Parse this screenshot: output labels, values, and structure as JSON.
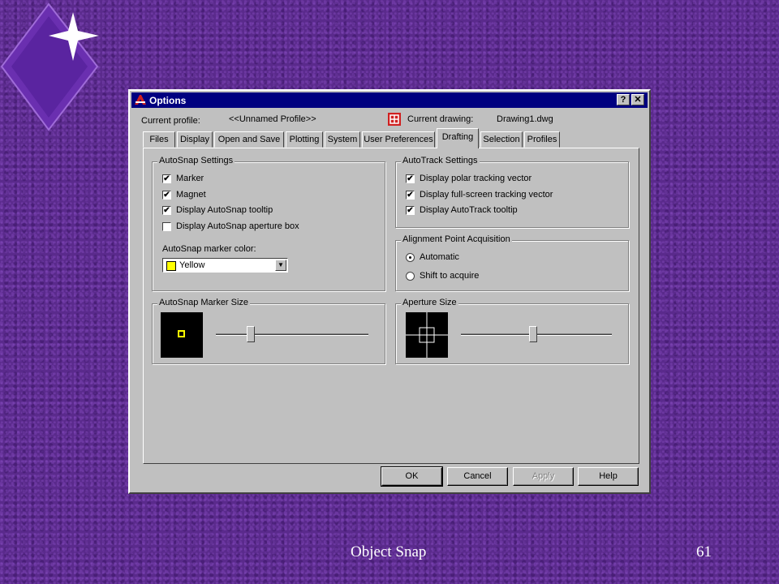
{
  "colors": {
    "background": "#5a2a8c",
    "titlebar": "#000080",
    "dialog": "#c0c0c0",
    "diamond": "#6a2fb0",
    "yellow_swatch": "#ffff00"
  },
  "window": {
    "title": "Options",
    "help_symbol": "?",
    "close_symbol": "✕"
  },
  "header": {
    "profile_label": "Current profile:",
    "profile_value": "<<Unnamed Profile>>",
    "drawing_label": "Current drawing:",
    "drawing_value": "Drawing1.dwg"
  },
  "tabs": [
    {
      "label": "Files"
    },
    {
      "label": "Display"
    },
    {
      "label": "Open and Save"
    },
    {
      "label": "Plotting"
    },
    {
      "label": "System"
    },
    {
      "label": "User Preferences"
    },
    {
      "label": "Drafting",
      "active": true
    },
    {
      "label": "Selection"
    },
    {
      "label": "Profiles"
    }
  ],
  "autosnap": {
    "title": "AutoSnap Settings",
    "options": [
      {
        "label": "Marker",
        "checked": true
      },
      {
        "label": "Magnet",
        "checked": true
      },
      {
        "label": "Display AutoSnap tooltip",
        "checked": true
      },
      {
        "label": "Display AutoSnap aperture box",
        "checked": false
      }
    ],
    "color_label": "AutoSnap marker color:",
    "color_value": "Yellow"
  },
  "autotrack": {
    "title": "AutoTrack Settings",
    "options": [
      {
        "label": "Display polar tracking vector",
        "checked": true
      },
      {
        "label": "Display full-screen tracking vector",
        "checked": true
      },
      {
        "label": "Display AutoTrack tooltip",
        "checked": true
      }
    ]
  },
  "alignment": {
    "title": "Alignment Point Acquisition",
    "options": [
      {
        "label": "Automatic",
        "selected": true
      },
      {
        "label": "Shift to acquire",
        "selected": false
      }
    ]
  },
  "marker_size": {
    "title": "AutoSnap Marker Size",
    "level": 0.23
  },
  "aperture_size": {
    "title": "Aperture Size",
    "level": 0.48
  },
  "buttons": {
    "ok": "OK",
    "cancel": "Cancel",
    "apply": "Apply",
    "help": "Help"
  },
  "check_mark": "✔",
  "footer": {
    "title": "Object Snap",
    "slide_number": "61"
  }
}
